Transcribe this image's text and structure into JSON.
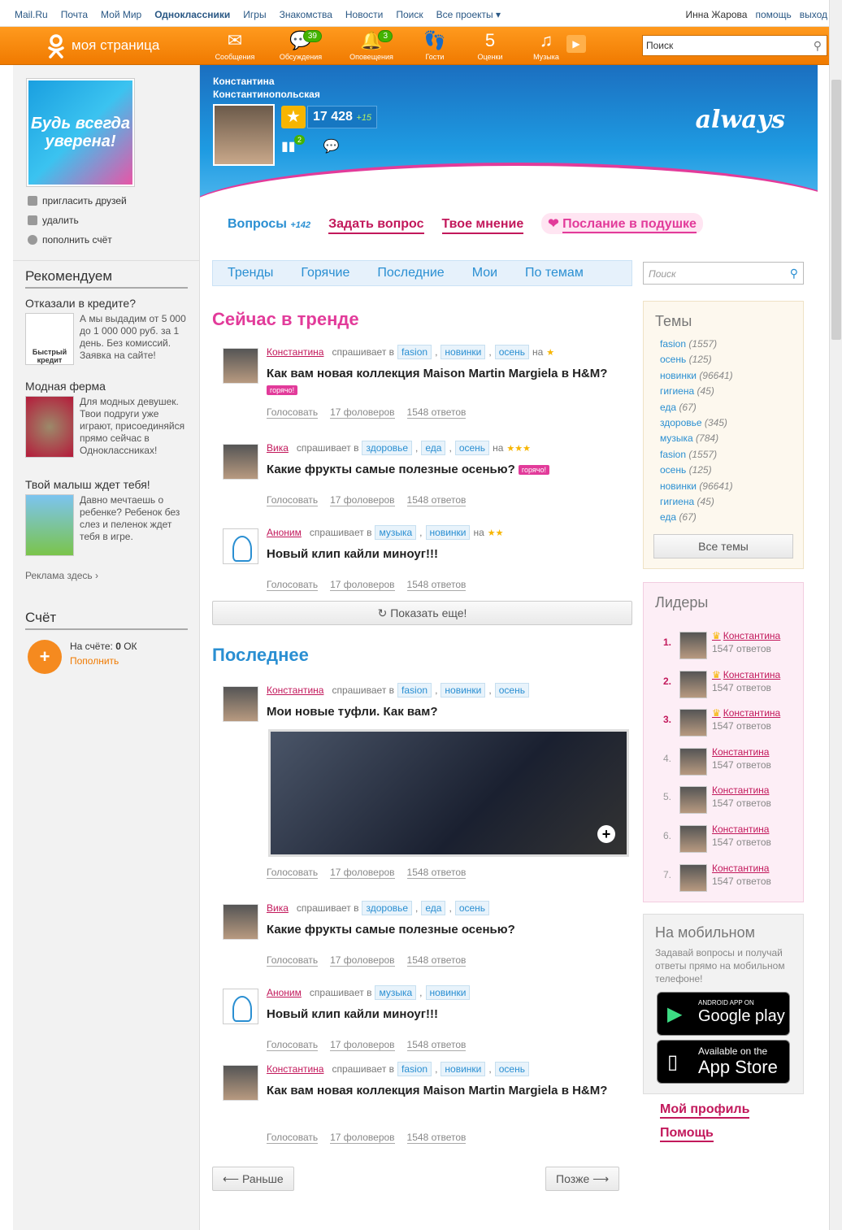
{
  "topbar": {
    "links": [
      "Mail.Ru",
      "Почта",
      "Мой Мир",
      "Одноклассники",
      "Игры",
      "Знакомства",
      "Новости",
      "Поиск",
      "Все проекты ▾"
    ],
    "user": "Инна Жарова",
    "help": "помощь",
    "logout": "выход"
  },
  "nav": {
    "mypage": "моя страница",
    "items": [
      {
        "label": "Сообщения",
        "icon": "envelope-icon",
        "badge": ""
      },
      {
        "label": "Обсуждения",
        "icon": "chat-icon",
        "badge": "39"
      },
      {
        "label": "Оповещения",
        "icon": "bell-icon",
        "badge": "3"
      },
      {
        "label": "Гости",
        "icon": "footprints-icon",
        "badge": ""
      },
      {
        "label": "Оценки",
        "icon": "rating-icon",
        "badge": ""
      },
      {
        "label": "Музыка",
        "icon": "music-icon",
        "badge": ""
      }
    ],
    "search_placeholder": "Поиск"
  },
  "left": {
    "avatar_text": "Будь всегда уверена!",
    "menu": [
      "пригласить друзей",
      "удалить",
      "пополнить счёт"
    ],
    "recommend_title": "Рекомендуем",
    "ads": [
      {
        "title": "Отказали в кредите?",
        "img_label": "Быстрый кредит",
        "desc": "А мы выдадим от 5 000 до 1 000 000 руб. за 1 день. Без комиссий. Заявка на сайте!"
      },
      {
        "title": "Модная ферма",
        "desc": "Для модных девушек. Твои подруги уже играют, присоединяйся прямо сейчас в Одноклассниках!"
      },
      {
        "title": "Твой малыш ждет тебя!",
        "desc": "Давно мечтаешь о ребенке? Ребенок без слез и пеленок ждет тебя в игре."
      }
    ],
    "ad_here": "Реклама здесь ›",
    "account_title": "Счёт",
    "balance_label": "На счёте:",
    "balance_value": "0",
    "balance_unit": "ОК",
    "topup": "Пополнить"
  },
  "profile": {
    "first": "Константина",
    "last": "Константинопольская",
    "score": "17 428",
    "delta": "+15",
    "level_badge": "2",
    "brand": "always"
  },
  "tabs": {
    "questions": "Вопросы",
    "questions_count": "+142",
    "ask": "Задать вопрос",
    "opinion": "Твое мнение",
    "pillow": "Послание в подушке"
  },
  "subnav": [
    "Тренды",
    "Горячие",
    "Последние",
    "Мои",
    "По темам"
  ],
  "search_placeholder": "Поиск",
  "trend_title": "Сейчас в тренде",
  "latest_title": "Последнее",
  "asks": "спрашивает в",
  "on": "на",
  "acts": [
    "Голосовать",
    "17 фоловеров",
    "1548 ответов"
  ],
  "hot": "горячо!",
  "trend": [
    {
      "user": "Константина",
      "tags": [
        "fasion",
        "новинки",
        "осень"
      ],
      "medals": "★",
      "title": "Как вам новая коллекция Maison Martin Margiela в H&M?",
      "hot": true
    },
    {
      "user": "Вика",
      "tags": [
        "здоровье",
        "еда",
        "осень"
      ],
      "medals": "★★★",
      "title": "Какие фрукты самые полезные осенью?",
      "hot": true
    },
    {
      "user": "Аноним",
      "tags": [
        "музыка",
        "новинки"
      ],
      "medals": "★★",
      "title": "Новый клип кайли миноуг!!!",
      "hot": false
    }
  ],
  "showmore": "Показать еще!",
  "latest": [
    {
      "user": "Константина",
      "tags": [
        "fasion",
        "новинки",
        "осень"
      ],
      "title": "Мои новые туфли. Как вам?"
    },
    {
      "user": "Вика",
      "tags": [
        "здоровье",
        "еда",
        "осень"
      ],
      "title": "Какие фрукты самые полезные осенью?"
    },
    {
      "user": "Аноним",
      "tags": [
        "музыка",
        "новинки"
      ],
      "title": "Новый клип кайли миноуг!!!"
    },
    {
      "user": "Константина",
      "tags": [
        "fasion",
        "новинки",
        "осень"
      ],
      "title": "Как вам новая коллекция Maison Martin Margiela в H&M?"
    }
  ],
  "pager": {
    "prev": "Раньше",
    "next": "Позже"
  },
  "themes": {
    "title": "Темы",
    "items": [
      [
        "fasion",
        "(1557)"
      ],
      [
        "осень",
        "(125)"
      ],
      [
        "новинки",
        "(96641)"
      ],
      [
        "гигиена",
        "(45)"
      ],
      [
        "еда",
        "(67)"
      ],
      [
        "здоровье",
        "(345)"
      ],
      [
        "музыка",
        "(784)"
      ],
      [
        "fasion",
        "(1557)"
      ],
      [
        "осень",
        "(125)"
      ],
      [
        "новинки",
        "(96641)"
      ],
      [
        "гигиена",
        "(45)"
      ],
      [
        "еда",
        "(67)"
      ]
    ],
    "all": "Все темы"
  },
  "leaders": {
    "title": "Лидеры",
    "items": [
      {
        "n": "1.",
        "name": "Константина",
        "answers": "1547 ответов",
        "crown": true
      },
      {
        "n": "2.",
        "name": "Константина",
        "answers": "1547 ответов",
        "crown": true
      },
      {
        "n": "3.",
        "name": "Константина",
        "answers": "1547 ответов",
        "crown": true
      },
      {
        "n": "4.",
        "name": "Константина",
        "answers": "1547 ответов",
        "crown": false
      },
      {
        "n": "5.",
        "name": "Константина",
        "answers": "1547 ответов",
        "crown": false
      },
      {
        "n": "6.",
        "name": "Константина",
        "answers": "1547 ответов",
        "crown": false
      },
      {
        "n": "7.",
        "name": "Константина",
        "answers": "1547 ответов",
        "crown": false
      }
    ]
  },
  "mobile": {
    "title": "На мобильном",
    "desc": "Задавай вопросы и получай ответы прямо на мобильном телефоне!",
    "gp_small": "ANDROID APP ON",
    "gp_big": "Google play",
    "as_small": "Available on the",
    "as_big": "App Store"
  },
  "footer_links": [
    "Мой профиль",
    "Помощь"
  ]
}
